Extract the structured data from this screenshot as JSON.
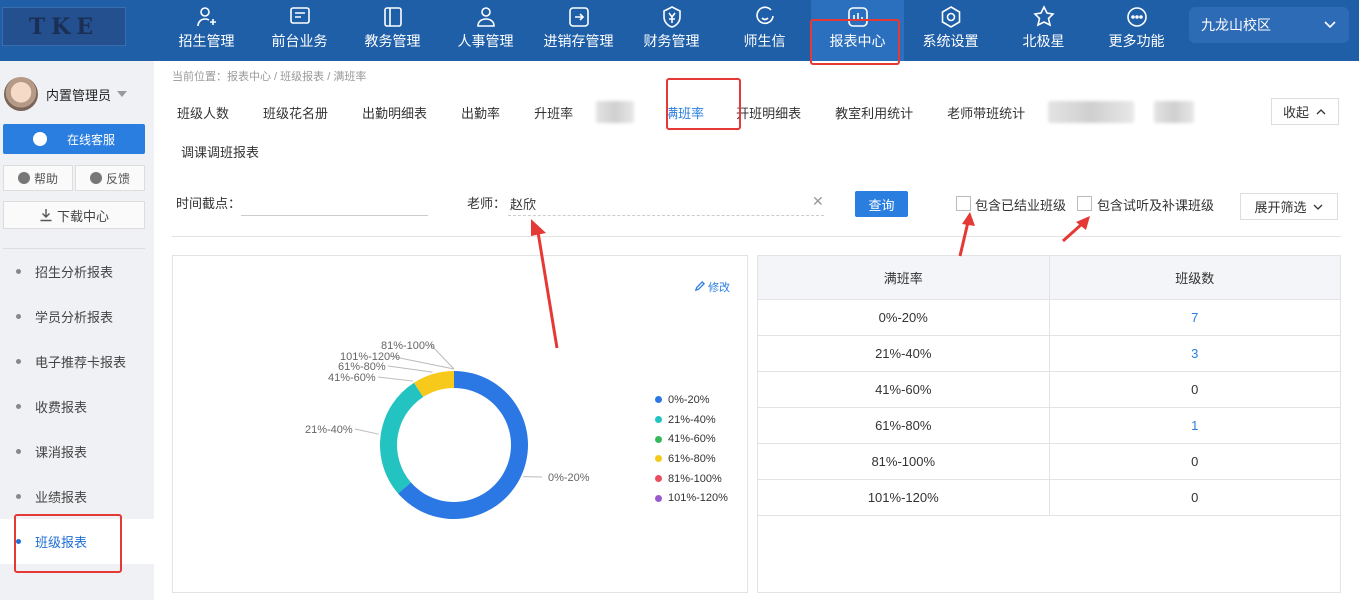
{
  "logo": {
    "text": "TKE"
  },
  "nav": [
    {
      "label": "招生管理",
      "icon": "add-user-icon"
    },
    {
      "label": "前台业务",
      "icon": "monitor-icon"
    },
    {
      "label": "教务管理",
      "icon": "book-icon"
    },
    {
      "label": "人事管理",
      "icon": "person-icon"
    },
    {
      "label": "进销存管理",
      "icon": "inventory-icon"
    },
    {
      "label": "财务管理",
      "icon": "yen-shield-icon"
    },
    {
      "label": "师生信",
      "icon": "chat-icon"
    },
    {
      "label": "报表中心",
      "icon": "report-icon"
    },
    {
      "label": "系统设置",
      "icon": "settings-icon"
    },
    {
      "label": "北极星",
      "icon": "star-icon"
    },
    {
      "label": "更多功能",
      "icon": "more-icon"
    }
  ],
  "campus": {
    "label": "九龙山校区"
  },
  "user": {
    "name": "内置管理员"
  },
  "sidebar": {
    "online_service": "在线客服",
    "help": "帮助",
    "feedback": "反馈",
    "download": "下载中心",
    "items": [
      "招生分析报表",
      "学员分析报表",
      "电子推荐卡报表",
      "收费报表",
      "课消报表",
      "业绩报表",
      "班级报表"
    ]
  },
  "breadcrumb": "当前位置：报表中心 / 班级报表 / 满班率",
  "tabs": [
    "班级人数",
    "班级花名册",
    "出勤明细表",
    "出勤率",
    "升班率",
    "满班率",
    "开班明细表",
    "教室利用统计",
    "老师带班统计"
  ],
  "tab_row2": "调课调班报表",
  "collapse_label": "收起",
  "filters": {
    "time_label": "时间截点：",
    "time_value": "",
    "teacher_label": "老师：",
    "teacher_value": "赵欣",
    "query_label": "查询",
    "include_closed": "包含已结业班级",
    "include_trial": "包含试听及补课班级",
    "expand_label": "展开筛选"
  },
  "edit_label": "修改",
  "table": {
    "headers": [
      "满班率",
      "班级数"
    ],
    "rows": [
      {
        "range": "0%-20%",
        "count": "7"
      },
      {
        "range": "21%-40%",
        "count": "3"
      },
      {
        "range": "41%-60%",
        "count": "0"
      },
      {
        "range": "61%-80%",
        "count": "1"
      },
      {
        "range": "81%-100%",
        "count": "0"
      },
      {
        "range": "101%-120%",
        "count": "0"
      }
    ]
  },
  "chart_data": {
    "type": "pie",
    "categories": [
      "0%-20%",
      "21%-40%",
      "41%-60%",
      "61%-80%",
      "81%-100%",
      "101%-120%"
    ],
    "values": [
      7,
      3,
      0,
      1,
      0,
      0
    ],
    "colors": [
      "#2b78e4",
      "#22c3c0",
      "#35b85a",
      "#f7c91b",
      "#ea4d5c",
      "#9b59d0"
    ],
    "legend": "right"
  }
}
